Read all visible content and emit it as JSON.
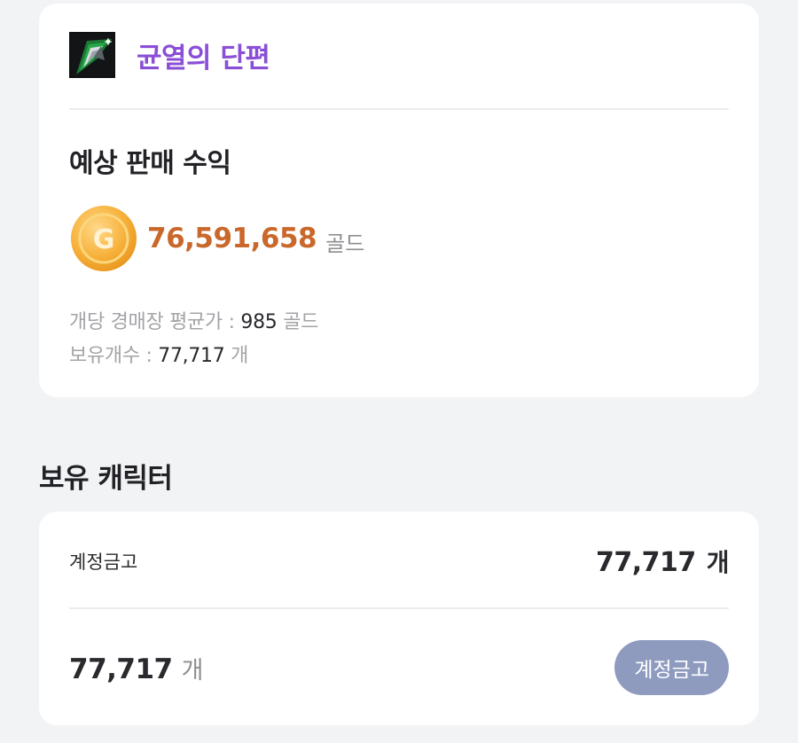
{
  "item": {
    "name": "균열의 단편",
    "icon": "crystal-shard-icon",
    "name_color": "#8a4fd6"
  },
  "earnings": {
    "title": "예상 판매 수익",
    "value": "76,591,658",
    "unit": "골드",
    "coin_icon": "gold-coin-icon",
    "coin_letter": "G",
    "value_color": "#c9682a"
  },
  "meta": {
    "avg_label": "개당 경매장 평균가 : ",
    "avg_value": "985",
    "avg_unit": " 골드",
    "owned_label": "보유개수 : ",
    "owned_value": "77,717",
    "owned_unit": " 개"
  },
  "characters": {
    "title": "보유 캐릭터",
    "rows": [
      {
        "label": "계정금고",
        "count": "77,717",
        "unit": "개"
      }
    ],
    "total": {
      "count": "77,717",
      "unit": "개"
    },
    "button_label": "계정금고",
    "button_color": "#8e9bbf"
  }
}
